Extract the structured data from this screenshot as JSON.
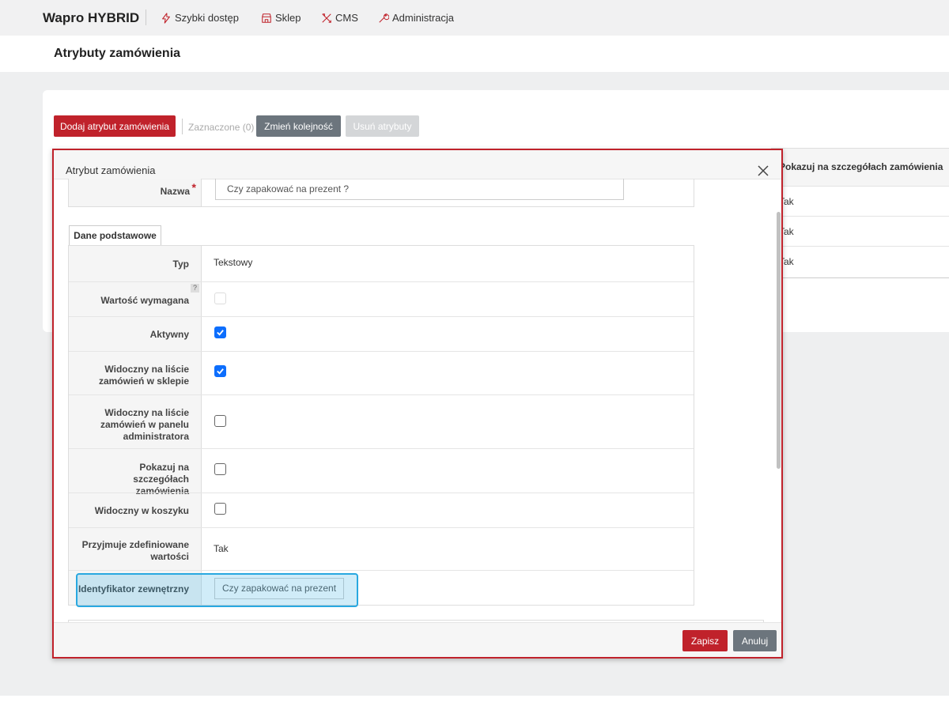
{
  "nav": {
    "brand": "Wapro HYBRID",
    "items": [
      {
        "label": "Szybki dostęp",
        "icon": "lightning-icon"
      },
      {
        "label": "Sklep",
        "icon": "store-icon"
      },
      {
        "label": "CMS",
        "icon": "tools-icon"
      },
      {
        "label": "Administracja",
        "icon": "wrench-icon"
      }
    ]
  },
  "page": {
    "title": "Atrybuty zamówienia"
  },
  "toolbar": {
    "add_label": "Dodaj atrybut zamówienia",
    "selected_label": "Zaznaczone (0)",
    "reorder_label": "Zmień kolejność",
    "delete_label": "Usuń atrybuty"
  },
  "table": {
    "header": "Pokazuj na szczegółach zamówienia",
    "cells": [
      "Tak",
      "Tak",
      "Tak"
    ]
  },
  "modal": {
    "title": "Atrybut zamówienia",
    "name_label": "Nazwa",
    "required_mark": "*",
    "name_value": "Czy zapakować na prezent ?",
    "tab_label": "Dane podstawowe",
    "help_mark": "?",
    "fields": {
      "type_label": "Typ",
      "type_value": "Tekstowy",
      "required_label": "Wartość wymagana",
      "required_checked": false,
      "active_label": "Aktywny",
      "active_checked": true,
      "shop_list_label": "Widoczny na liście zamówień w sklepie",
      "shop_list_checked": true,
      "admin_list_label": "Widoczny na liście zamówień w panelu administratora",
      "admin_list_checked": false,
      "details_label": "Pokazuj na szczegółach zamówienia",
      "details_checked": false,
      "cart_label": "Widoczny w koszyku",
      "cart_checked": false,
      "predefined_label": "Przyjmuje zdefiniowane wartości",
      "predefined_value": "Tak",
      "external_id_label": "Identyfikator zewnętrzny",
      "external_id_value": "Czy zapakować na prezent"
    },
    "save_label": "Zapisz",
    "cancel_label": "Anuluj"
  },
  "colors": {
    "accent_red": "#c0222b",
    "gray_button": "#6c757d",
    "checkbox_blue": "#0d6efd",
    "highlight": "#29a8e0"
  }
}
